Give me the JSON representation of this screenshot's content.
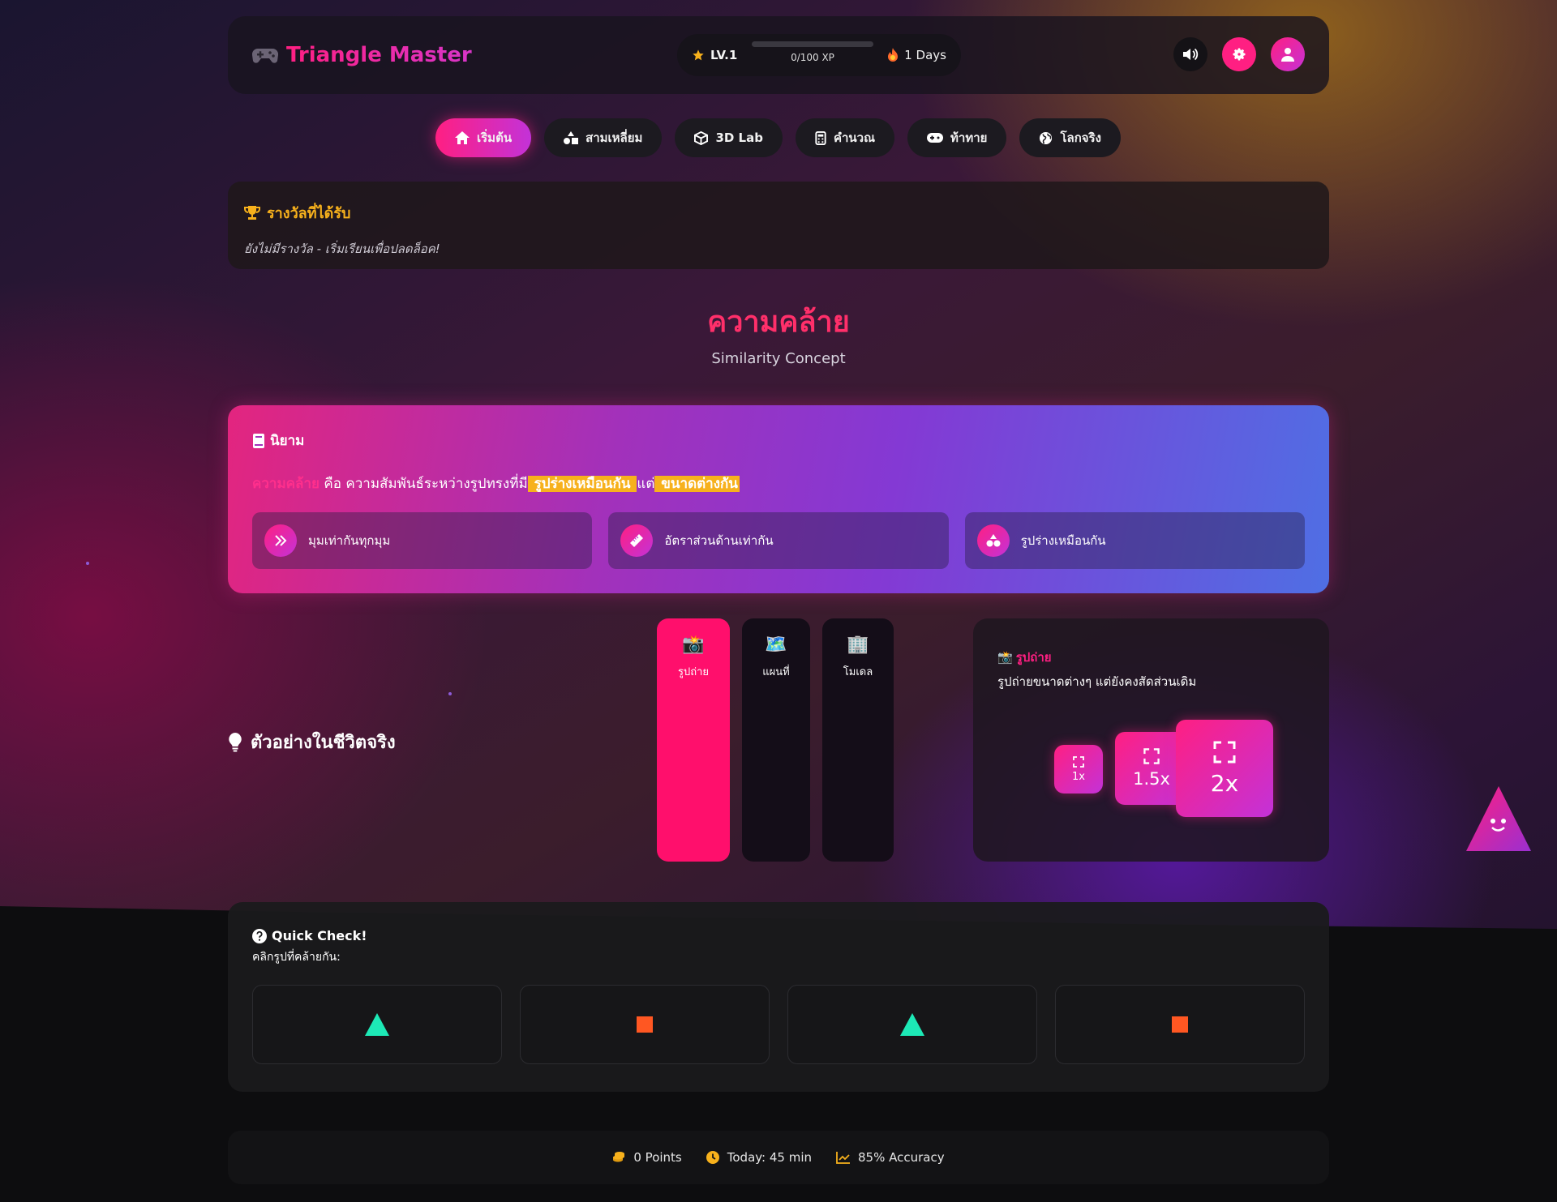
{
  "app": {
    "title": "Triangle Master",
    "level": "LV.1",
    "xp_text": "0/100 XP",
    "xp_progress": 0,
    "streak": "1 Days"
  },
  "nav": {
    "tabs": [
      {
        "label": "เริ่มต้น",
        "icon": "home-icon",
        "active": true
      },
      {
        "label": "สามเหลี่ยม",
        "icon": "shapes-icon",
        "active": false
      },
      {
        "label": "3D Lab",
        "icon": "cube-icon",
        "active": false
      },
      {
        "label": "คำนวณ",
        "icon": "calculator-icon",
        "active": false
      },
      {
        "label": "ท้าทาย",
        "icon": "gamepad-icon",
        "active": false
      },
      {
        "label": "โลกจริง",
        "icon": "globe-icon",
        "active": false
      }
    ]
  },
  "rewards": {
    "title": "รางวัลที่ได้รับ",
    "empty_text": "ยังไม่มีรางวัล - เริ่มเรียนเพื่อปลดล็อค!"
  },
  "concept": {
    "title": "ความคล้าย",
    "subtitle": "Similarity Concept"
  },
  "definition": {
    "title": "นิยาม",
    "term": "ความคล้าย",
    "text_1": " คือ ความสัมพันธ์ระหว่างรูปทรงที่มี",
    "highlight_1": " รูปร่างเหมือนกัน ",
    "text_2": " แต่",
    "highlight_2": " ขนาดต่างกัน ",
    "properties": [
      {
        "label": "มุมเท่ากันทุกมุม",
        "icon": "double-chevron-icon"
      },
      {
        "label": "อัตราส่วนด้านเท่ากัน",
        "icon": "ruler-icon"
      },
      {
        "label": "รูปร่างเหมือนกัน",
        "icon": "shapes-icon"
      }
    ]
  },
  "real_life": {
    "title": "ตัวอย่างในชีวิตจริง",
    "categories": [
      {
        "label": "รูปถ่าย",
        "icon": "📸",
        "active": true
      },
      {
        "label": "แผนที่",
        "icon": "🗺️",
        "active": false
      },
      {
        "label": "โมเดล",
        "icon": "🏢",
        "active": false
      }
    ],
    "example": {
      "icon": "📸",
      "title": "รูปถ่าย",
      "description": "รูปถ่ายขนาดต่างๆ แต่ยังคงสัดส่วนเดิม",
      "scales": [
        "1x",
        "1.5x",
        "2x"
      ]
    }
  },
  "quick_check": {
    "title": "Quick Check!",
    "subtitle": "คลิกรูปที่คล้ายกัน:",
    "options": [
      {
        "shape": "triangle",
        "color": "#1de9b6"
      },
      {
        "shape": "square",
        "color": "#ff5722"
      },
      {
        "shape": "triangle",
        "color": "#1de9b6"
      },
      {
        "shape": "square",
        "color": "#ff5722"
      }
    ]
  },
  "stats": {
    "points": "0 Points",
    "today": "Today: 45 min",
    "accuracy": "85% Accuracy"
  },
  "colors": {
    "accent": "#ff1f82",
    "purple": "#c332d8",
    "gold": "#f7b11c"
  }
}
